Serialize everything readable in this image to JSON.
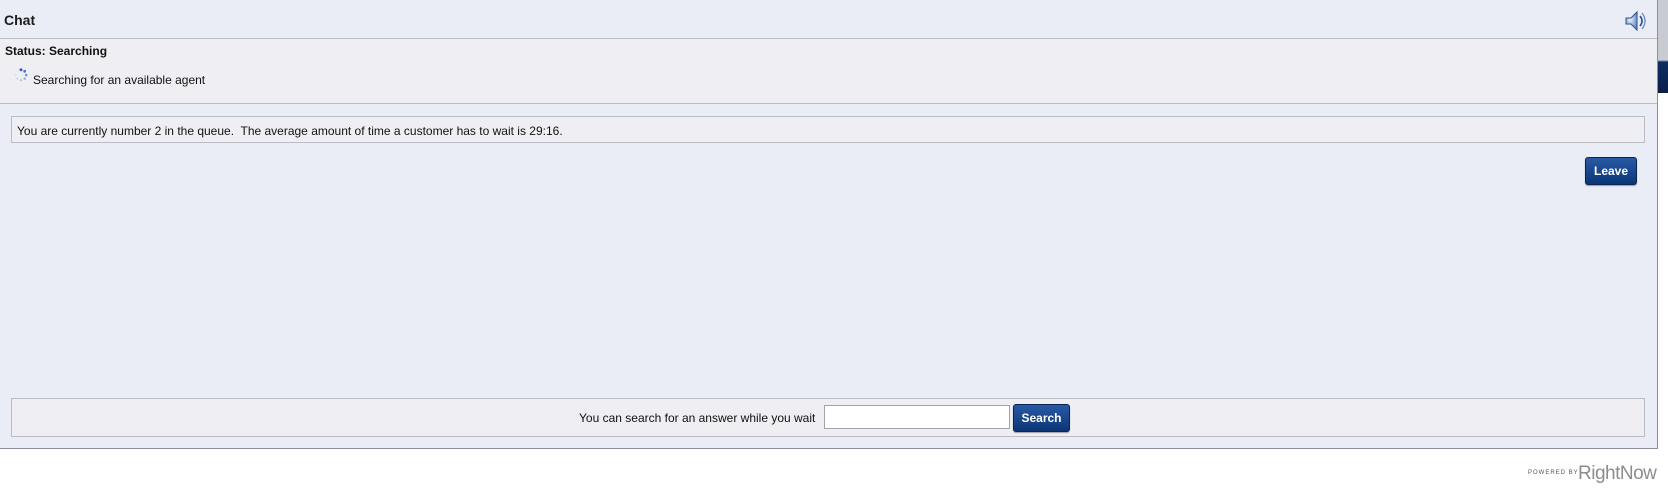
{
  "header": {
    "title": "Chat",
    "sound_icon": "speaker-icon"
  },
  "status": {
    "label": "Status: Searching",
    "spinner_icon": "loading-spinner-icon",
    "message": "Searching for an available agent"
  },
  "queue": {
    "message": "You are currently number 2 in the queue.  The average amount of time a customer has to wait is 29:16."
  },
  "actions": {
    "leave_label": "Leave"
  },
  "search": {
    "label": "You can search for an answer while you wait",
    "input_value": "",
    "button_label": "Search"
  },
  "footer": {
    "powered_by": "POWERED BY",
    "brand": "RightNow"
  },
  "colors": {
    "panel_bg": "#eaedf5",
    "button_bg": "#0b3575",
    "border": "#b9bcc4"
  }
}
